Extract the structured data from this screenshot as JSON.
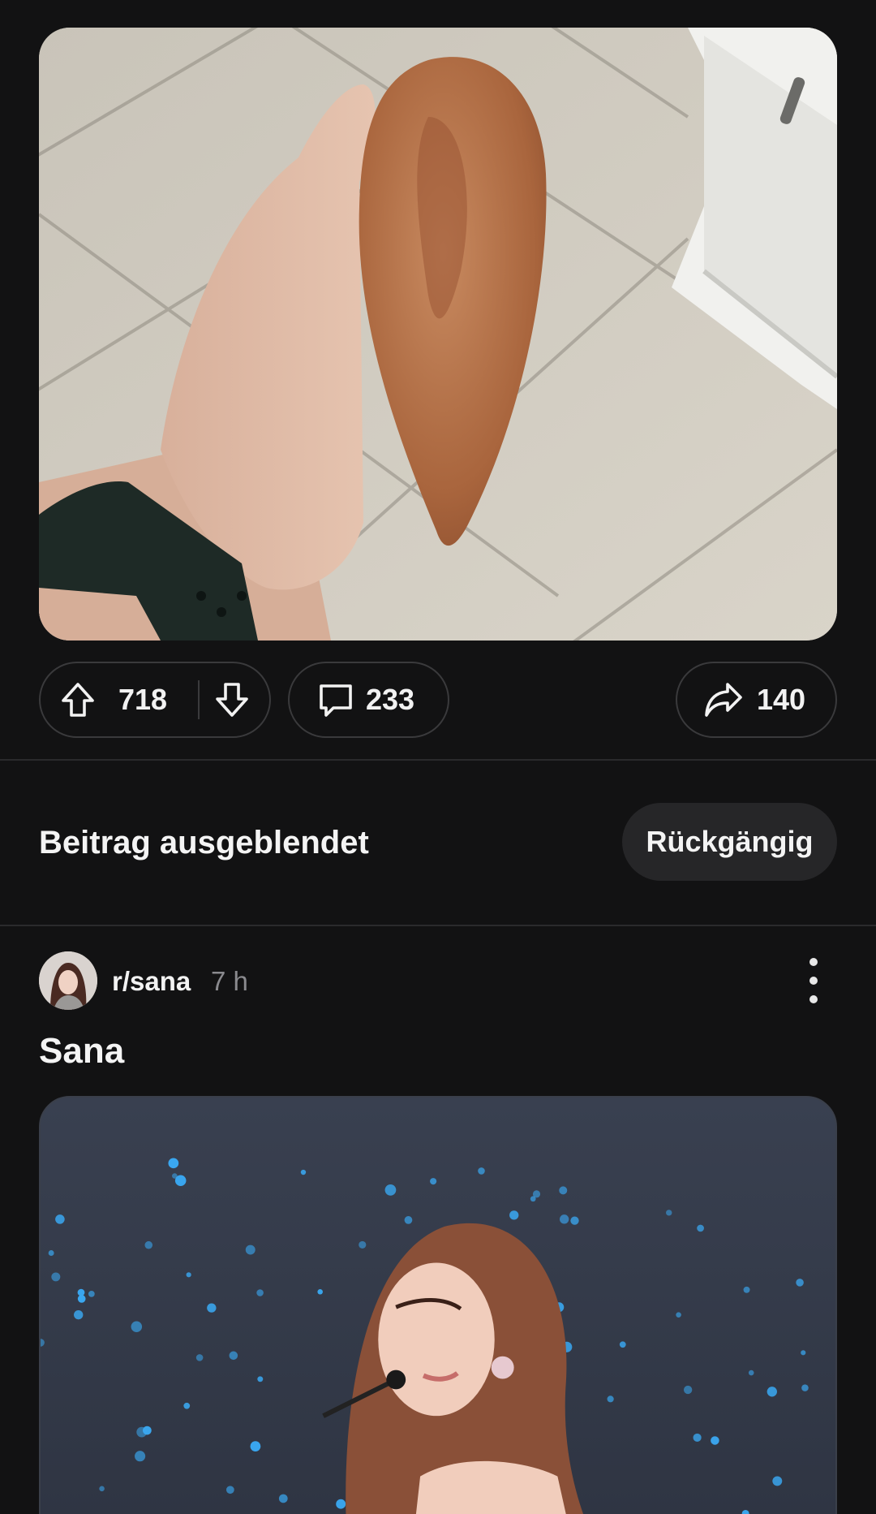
{
  "post1": {
    "image_alt": "",
    "actions": {
      "upvote_icon": "arrow-up-icon",
      "score": "718",
      "downvote_icon": "arrow-down-icon",
      "comment_icon": "comment-bubble-icon",
      "comments": "233",
      "share_icon": "share-arrow-icon",
      "shares": "140"
    }
  },
  "hidden_notice": {
    "label": "Beitrag ausgeblendet",
    "undo_label": "Rückgängig"
  },
  "post2": {
    "subreddit": "r/sana",
    "age": "7 h",
    "title": "Sana",
    "menu_icon": "more-vertical-icon"
  },
  "colors": {
    "background": "#121213",
    "pill_border": "#3a3a3c",
    "undo_bg": "#262628",
    "muted_text": "#8a8a8e",
    "stage_dot": "#3aa7f0"
  }
}
